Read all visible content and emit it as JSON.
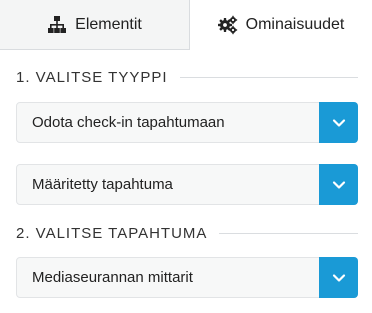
{
  "tabs": [
    {
      "label": "Elementit",
      "icon": "sitemap-icon",
      "active": false
    },
    {
      "label": "Ominaisuudet",
      "icon": "gears-icon",
      "active": true
    }
  ],
  "sections": [
    {
      "heading": "1. VALITSE TYYPPI",
      "selects": [
        {
          "value": "Odota check-in tapahtumaan"
        },
        {
          "value": "Määritetty tapahtuma"
        }
      ]
    },
    {
      "heading": "2. VALITSE TAPAHTUMA",
      "selects": [
        {
          "value": "Mediaseurannan mittarit"
        }
      ]
    }
  ],
  "colors": {
    "accent": "#1a9ad6",
    "tab_inactive_bg": "#f4f5f5",
    "select_bg": "#f7f8f8"
  }
}
